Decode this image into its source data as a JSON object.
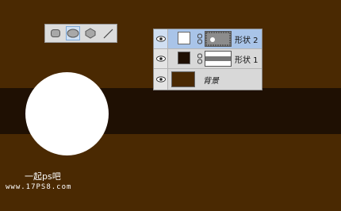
{
  "toolbar": {
    "tools": [
      {
        "icon": "rounded-rectangle-tool-icon"
      },
      {
        "icon": "ellipse-tool-icon",
        "active": true
      },
      {
        "icon": "polygon-tool-icon"
      },
      {
        "icon": "line-tool-icon"
      }
    ]
  },
  "layers": [
    {
      "name": "形状 2",
      "thumb_color": "#ffffff",
      "has_mask": true,
      "mask_content": "circle",
      "selected": true
    },
    {
      "name": "形状 1",
      "thumb_color": "#1f1003",
      "has_mask": true,
      "mask_content": "band",
      "selected": false
    },
    {
      "name": "背景",
      "thumb_color": "#4a2902",
      "has_mask": false,
      "selected": false
    }
  ],
  "canvas": {
    "background_color": "#4a2902",
    "band_color": "#1f1003",
    "circle_color": "#ffffff"
  },
  "watermark": {
    "line1": "一起ps吧",
    "line2": "www.17PS8.com"
  }
}
